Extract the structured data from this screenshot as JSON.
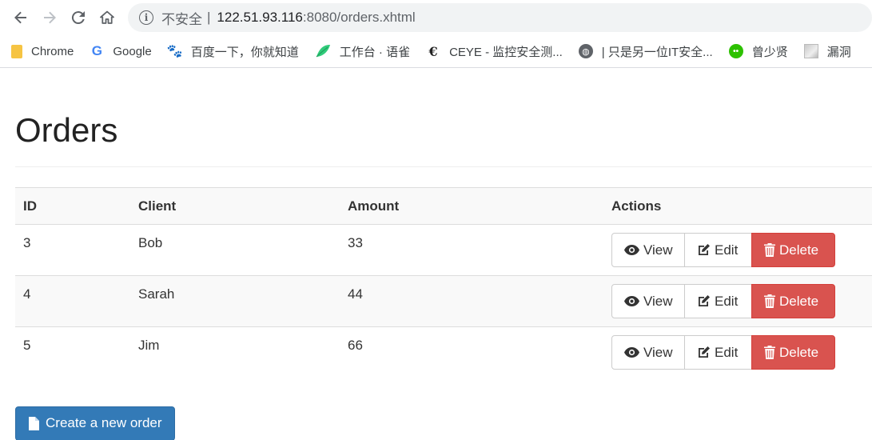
{
  "browser": {
    "insecure_label": "不安全",
    "separator": "|",
    "url_host": "122.51.93.116",
    "url_path": ":8080/orders.xhtml"
  },
  "bookmarks": [
    {
      "label": "Chrome",
      "icon": "folder-icon"
    },
    {
      "label": "Google",
      "icon": "google-icon"
    },
    {
      "label": "百度一下，你就知道",
      "icon": "baidu-paw-icon"
    },
    {
      "label": "工作台 · 语雀",
      "icon": "yuque-leaf-icon"
    },
    {
      "label": "CEYE - 监控安全测...",
      "icon": "ceye-icon"
    },
    {
      "label": "| 只是另一位IT安全...",
      "icon": "globe-icon"
    },
    {
      "label": "曾少贤",
      "icon": "wechat-icon"
    },
    {
      "label": "漏洞",
      "icon": "image-icon"
    }
  ],
  "page": {
    "title": "Orders",
    "create_button": "Create a new order"
  },
  "table": {
    "headers": [
      "ID",
      "Client",
      "Amount",
      "Actions"
    ],
    "rows": [
      {
        "id": "3",
        "client": "Bob",
        "amount": "33"
      },
      {
        "id": "4",
        "client": "Sarah",
        "amount": "44"
      },
      {
        "id": "5",
        "client": "Jim",
        "amount": "66"
      }
    ],
    "actions": {
      "view": "View",
      "edit": "Edit",
      "delete": "Delete"
    }
  },
  "colors": {
    "primary": "#337ab7",
    "danger": "#d9534f"
  }
}
